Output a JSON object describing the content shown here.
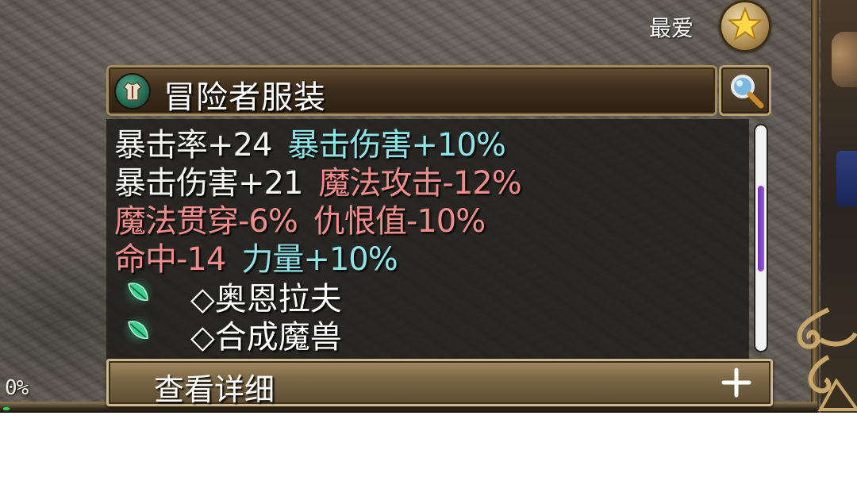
{
  "favorite": {
    "label": "最爱",
    "icon": "star-icon"
  },
  "item": {
    "title": "冒险者服装",
    "icon": "armor-icon",
    "search_icon": "magnifier-icon"
  },
  "stats": [
    [
      {
        "text": "暴击率+24",
        "color": "white"
      },
      {
        "text": "暴击伤害+10%",
        "color": "cyan"
      }
    ],
    [
      {
        "text": "暴击伤害+21",
        "color": "white"
      },
      {
        "text": "魔法攻击-12%",
        "color": "red"
      }
    ],
    [
      {
        "text": "魔法贯穿-6%",
        "color": "red"
      },
      {
        "text": "仇恨值-10%",
        "color": "red"
      }
    ],
    [
      {
        "text": "命中-14",
        "color": "red"
      },
      {
        "text": "力量+10%",
        "color": "cyan"
      }
    ]
  ],
  "set_items": [
    {
      "icon": "green-leaf-icon",
      "text": "◇奥恩拉夫"
    },
    {
      "icon": "green-leaf-icon",
      "text": "◇合成魔兽"
    }
  ],
  "details": {
    "label": "查看详细",
    "icon": "plus-icon"
  },
  "progress": {
    "text": "0%",
    "value": 0
  },
  "colors": {
    "white": "#f4f4f0",
    "cyan": "#8fe4e8",
    "red": "#f08c8a",
    "scroll_thumb": "#8a48d8"
  }
}
